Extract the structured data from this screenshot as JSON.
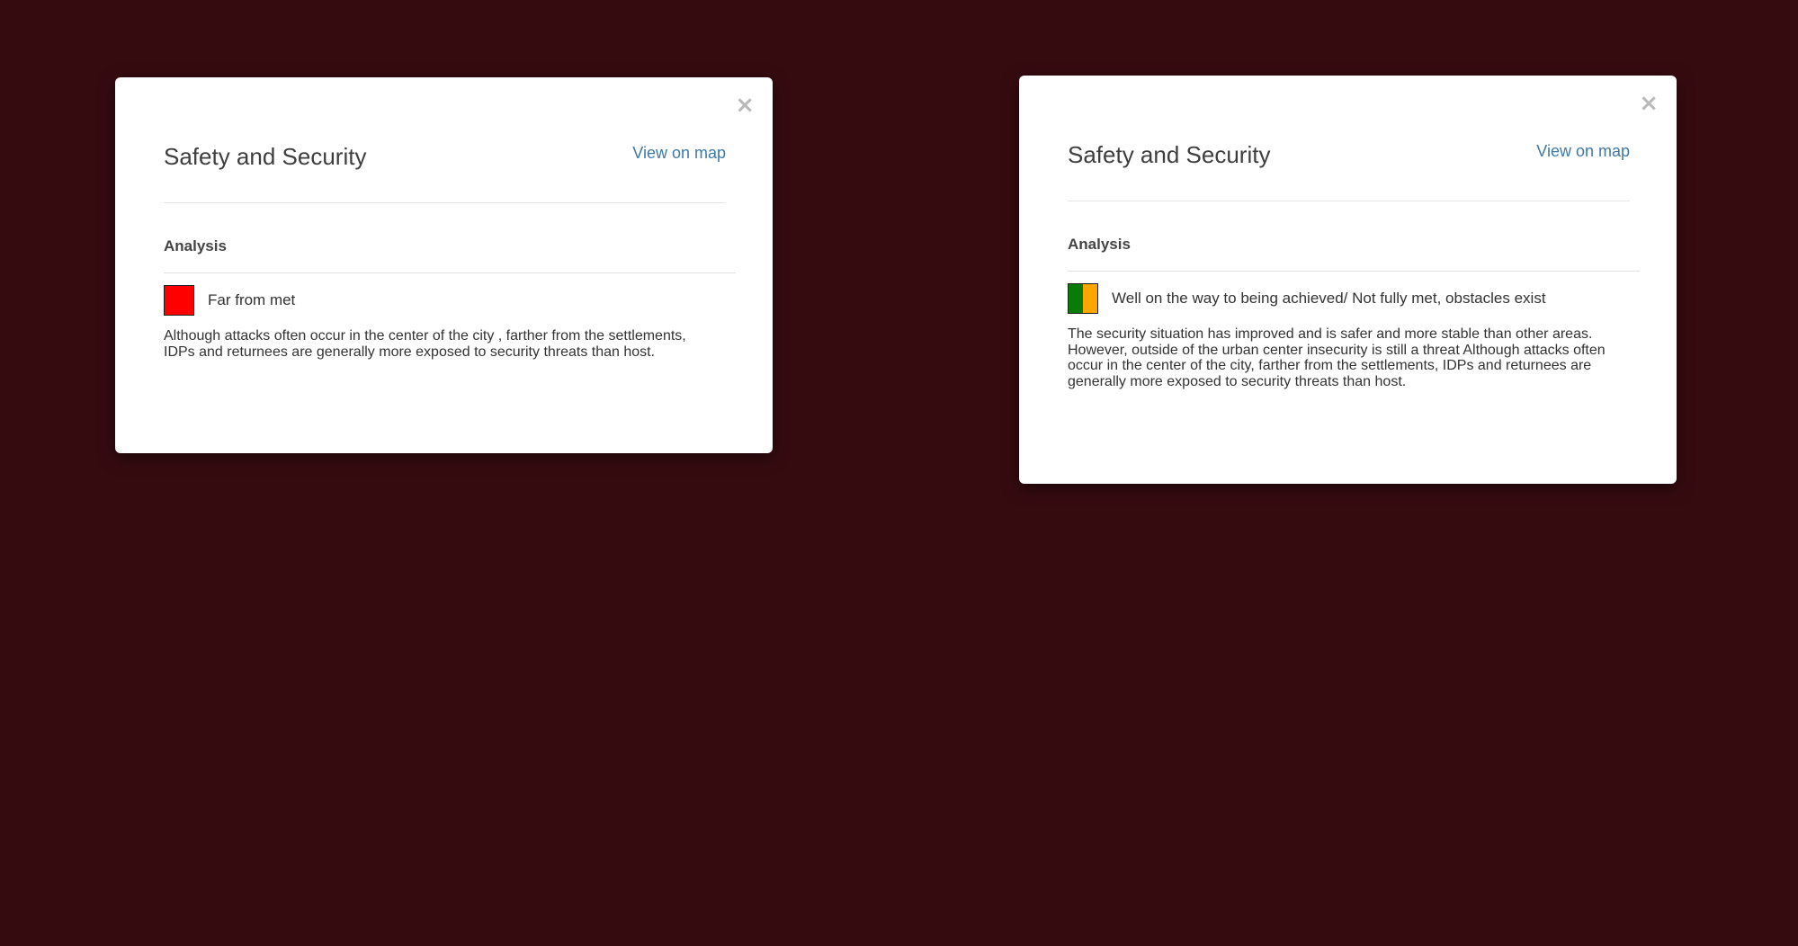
{
  "modals": [
    {
      "close_label": "×",
      "title": "Safety and Security",
      "map_link": "View on map",
      "section_title": "Analysis",
      "status_label": "Far from met",
      "status_colors": [
        "#ff0000"
      ],
      "analysis_text": "Although attacks often occur in the center of the city , farther from the settlements, IDPs and returnees are generally more exposed to security threats than host."
    },
    {
      "close_label": "×",
      "title": "Safety and Security",
      "map_link": "View on map",
      "section_title": "Analysis",
      "status_label": "Well on the way to being achieved/ Not fully met, obstacles exist",
      "status_colors": [
        "#0b7a0b",
        "#ffa500"
      ],
      "analysis_text": "The security situation has improved and is safer and more stable than other areas. However, outside of the urban center insecurity is still a threat Although attacks often occur in the center of the city, farther from the settlements, IDPs and returnees are generally more exposed to security threats than host."
    }
  ],
  "background_color": "#360b10"
}
